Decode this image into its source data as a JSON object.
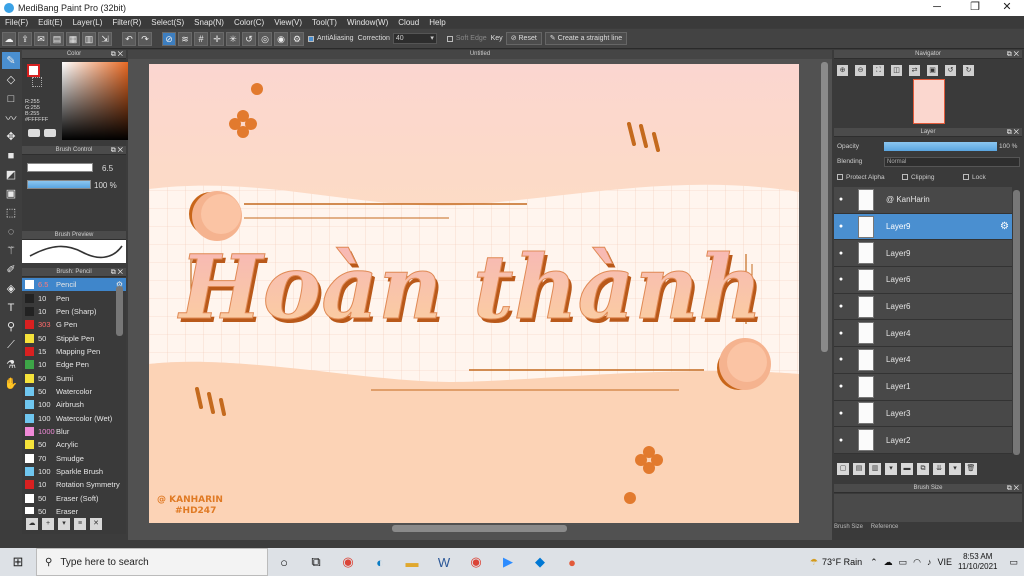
{
  "app": {
    "title": "MediBang Paint Pro (32bit)",
    "window_controls": [
      "─",
      "❐",
      "✕"
    ]
  },
  "menu": [
    "File(F)",
    "Edit(E)",
    "Layer(L)",
    "Filter(R)",
    "Select(S)",
    "Snap(N)",
    "Color(C)",
    "View(V)",
    "Tool(T)",
    "Window(W)",
    "Cloud",
    "Help"
  ],
  "toolbar": {
    "antialias": "AntiAliasing",
    "correction_label": "Correction",
    "correction_value": "40",
    "soft_edge": "Soft Edge",
    "key": "Key",
    "reset": "Reset",
    "straight_line": "Create a straight line"
  },
  "panels": {
    "color": "Color",
    "brush_control": "Brush Control",
    "brush_preview": "Brush Preview",
    "brush_list": "Brush: Pencil",
    "navigator": "Navigator",
    "layer": "Layer",
    "brush_size": "Brush Size"
  },
  "color": {
    "r": "R:255",
    "g": "G:255",
    "b": "B:255",
    "hex": "#FFFFFF",
    "fg": "#ffffff"
  },
  "brush_control": {
    "size": "6.5",
    "opacity": "100 %"
  },
  "brushes": [
    {
      "size": "6.5",
      "name": "Pencil",
      "color": "#ffffff",
      "selected": true
    },
    {
      "size": "10",
      "name": "Pen",
      "color": "#222222"
    },
    {
      "size": "10",
      "name": "Pen (Sharp)",
      "color": "#222222"
    },
    {
      "size": "303",
      "name": "G Pen",
      "color": "#d92020"
    },
    {
      "size": "50",
      "name": "Stipple Pen",
      "color": "#f5e23a"
    },
    {
      "size": "15",
      "name": "Mapping Pen",
      "color": "#d92020"
    },
    {
      "size": "10",
      "name": "Edge Pen",
      "color": "#3da547"
    },
    {
      "size": "50",
      "name": "Sumi",
      "color": "#f5e23a"
    },
    {
      "size": "50",
      "name": "Watercolor",
      "color": "#6fc6ef"
    },
    {
      "size": "100",
      "name": "Airbrush",
      "color": "#6fc6ef"
    },
    {
      "size": "100",
      "name": "Watercolor (Wet)",
      "color": "#6fc6ef"
    },
    {
      "size": "1000",
      "name": "Blur",
      "color": "#f08ad8"
    },
    {
      "size": "50",
      "name": "Acrylic",
      "color": "#f5e23a"
    },
    {
      "size": "70",
      "name": "Smudge",
      "color": "#ffffff"
    },
    {
      "size": "100",
      "name": "Sparkle Brush",
      "color": "#6fc6ef"
    },
    {
      "size": "10",
      "name": "Rotation Symmetry",
      "color": "#d92020"
    },
    {
      "size": "50",
      "name": "Eraser (Soft)",
      "color": "#ffffff"
    },
    {
      "size": "50",
      "name": "Eraser",
      "color": "#ffffff"
    }
  ],
  "document": {
    "title": "Untitled"
  },
  "artwork": {
    "text": "Hoàn thành",
    "signature_line1": "@ KANHARIN",
    "signature_line2": "#HD247"
  },
  "layer_panel": {
    "opacity_label": "Opacity",
    "opacity_value": "100 %",
    "blending_label": "Blending",
    "blending_value": "Normal",
    "protect_alpha": "Protect Alpha",
    "clipping": "Clipping",
    "lock": "Lock"
  },
  "layers": [
    {
      "name": "@ KanHarin",
      "selected": false
    },
    {
      "name": "Layer9",
      "selected": true
    },
    {
      "name": "Layer9",
      "selected": false
    },
    {
      "name": "Layer6",
      "selected": false
    },
    {
      "name": "Layer6",
      "selected": false
    },
    {
      "name": "Layer4",
      "selected": false
    },
    {
      "name": "Layer4",
      "selected": false
    },
    {
      "name": "Layer1",
      "selected": false
    },
    {
      "name": "Layer3",
      "selected": false
    },
    {
      "name": "Layer2",
      "selected": false
    }
  ],
  "brush_size_tabs": [
    "Brush Size",
    "Reference"
  ],
  "taskbar": {
    "search_placeholder": "Type here to search",
    "weather": "73°F Rain",
    "lang": "VIE",
    "time": "8:53 AM",
    "date": "11/10/2021"
  }
}
